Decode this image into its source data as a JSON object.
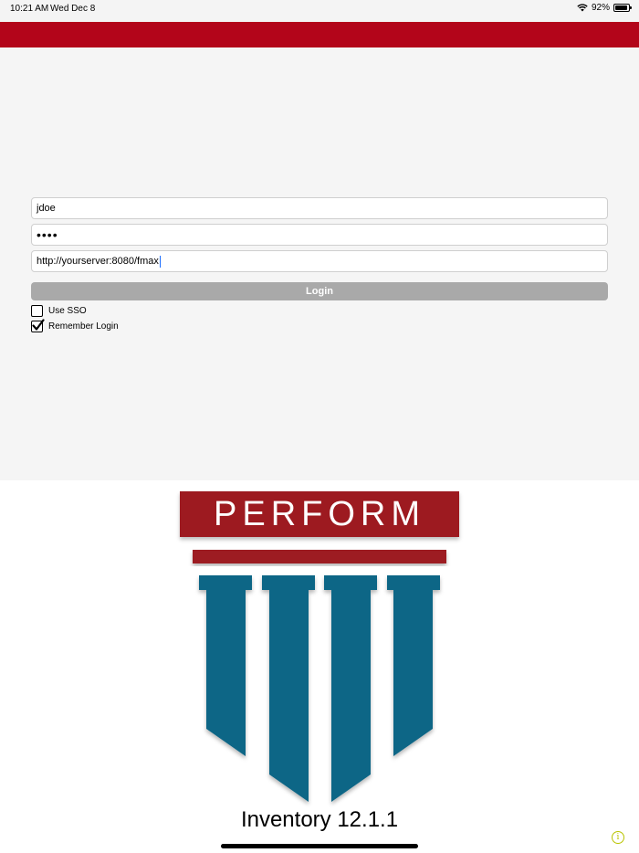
{
  "status_bar": {
    "time": "10:21 AM",
    "date": "Wed Dec 8",
    "battery_percent": "92%",
    "battery_level": 0.92,
    "icons": [
      "wifi-icon",
      "battery-icon"
    ]
  },
  "colors": {
    "header_red": "#b3051a",
    "logo_red": "#9d1a20",
    "logo_teal": "#116686",
    "button_gray": "#a9a9a9",
    "panel_bg": "#f5f5f5"
  },
  "login": {
    "username_value": "jdoe",
    "password_value": "••••",
    "server_value": "http://yourserver:8080/fmax",
    "login_label": "Login",
    "use_sso_label": "Use SSO",
    "use_sso_checked": false,
    "remember_label": "Remember Login",
    "remember_checked": true
  },
  "logo": {
    "brand_text": "PERFORM",
    "product_version": "Inventory 12.1.1"
  },
  "footer": {
    "info_icon_glyph": "i"
  }
}
